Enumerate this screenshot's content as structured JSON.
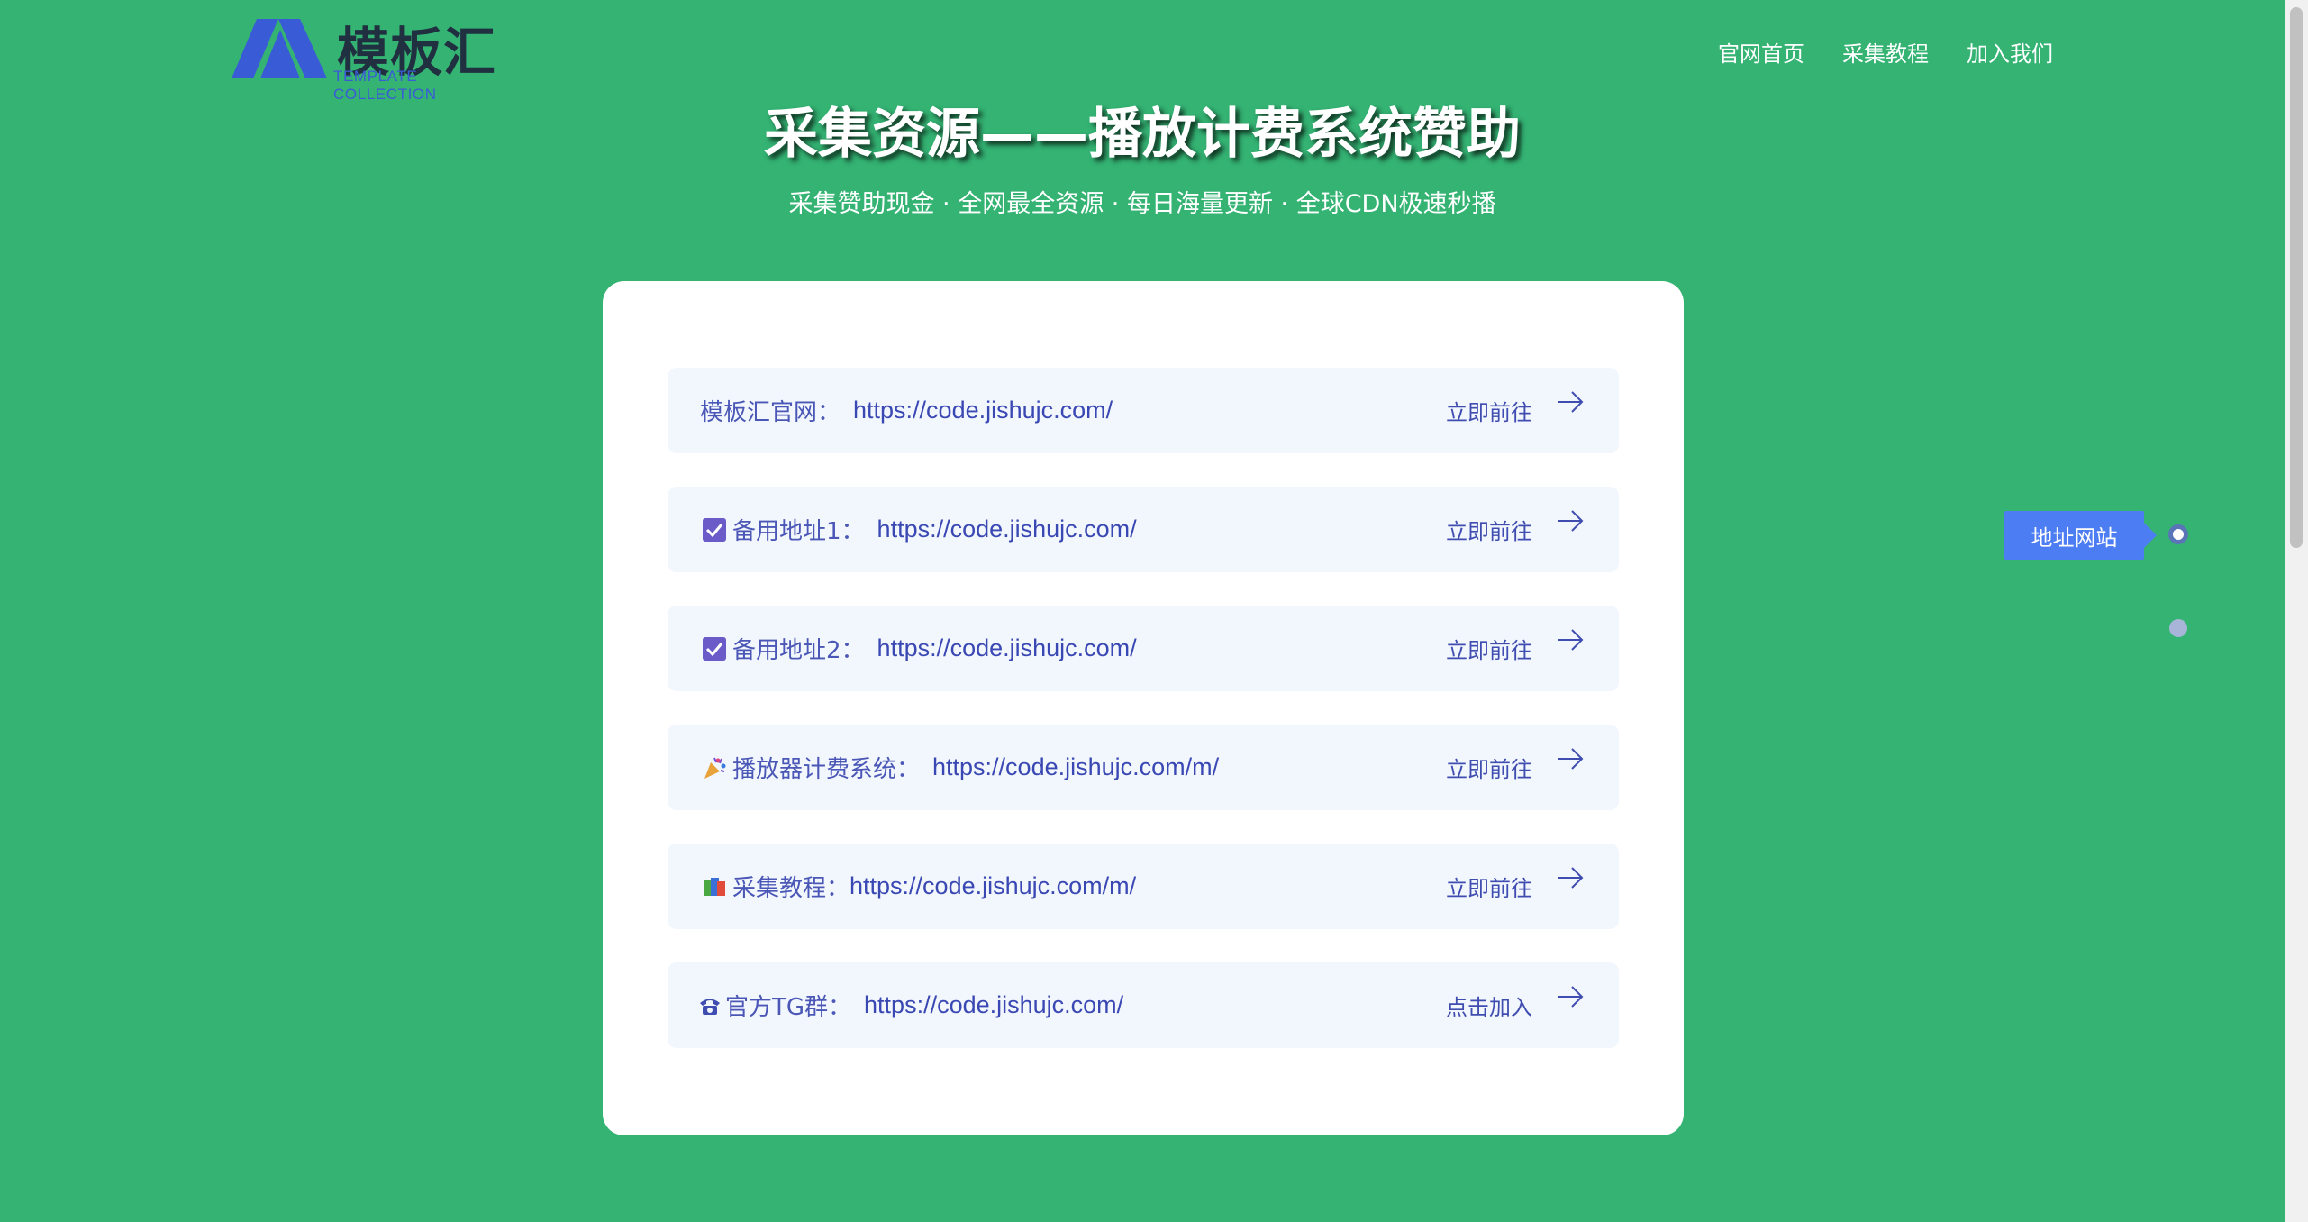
{
  "logo": {
    "title": "模板汇",
    "subtitle": "TEMPLATE COLLECTION",
    "colors": {
      "mark": "#3a5bd6",
      "title": "#203040"
    }
  },
  "nav": {
    "items": [
      {
        "label": "官网首页"
      },
      {
        "label": "采集教程"
      },
      {
        "label": "加入我们"
      }
    ]
  },
  "hero": {
    "title": "采集资源——播放计费系统赞助",
    "subtitle": "采集赞助现金 · 全网最全资源 · 每日海量更新 · 全球CDN极速秒播"
  },
  "links": [
    {
      "icon": "",
      "label": "模板汇官网：",
      "url": "https://code.jishujc.com/",
      "action": "立即前往"
    },
    {
      "icon": "checkbox-icon",
      "label": "备用地址1：",
      "url": "https://code.jishujc.com/",
      "action": "立即前往"
    },
    {
      "icon": "checkbox-icon",
      "label": "备用地址2：",
      "url": "https://code.jishujc.com/",
      "action": "立即前往"
    },
    {
      "icon": "party-popper-icon",
      "label": "播放器计费系统：",
      "url": "https://code.jishujc.com/m/",
      "action": "立即前往"
    },
    {
      "icon": "books-icon",
      "label": "采集教程：",
      "url": "https://code.jishujc.com/m/",
      "action": "立即前往"
    },
    {
      "icon": "telephone-icon",
      "label": "官方TG群：",
      "url": "https://code.jishujc.com/",
      "action": "点击加入"
    }
  ],
  "side_nav": {
    "active_label": "地址网站"
  },
  "colors": {
    "background": "#34b373",
    "card": "#ffffff",
    "item_bg": "#f2f6fd",
    "link_text": "#3f4db0",
    "accent": "#4d7df2"
  }
}
